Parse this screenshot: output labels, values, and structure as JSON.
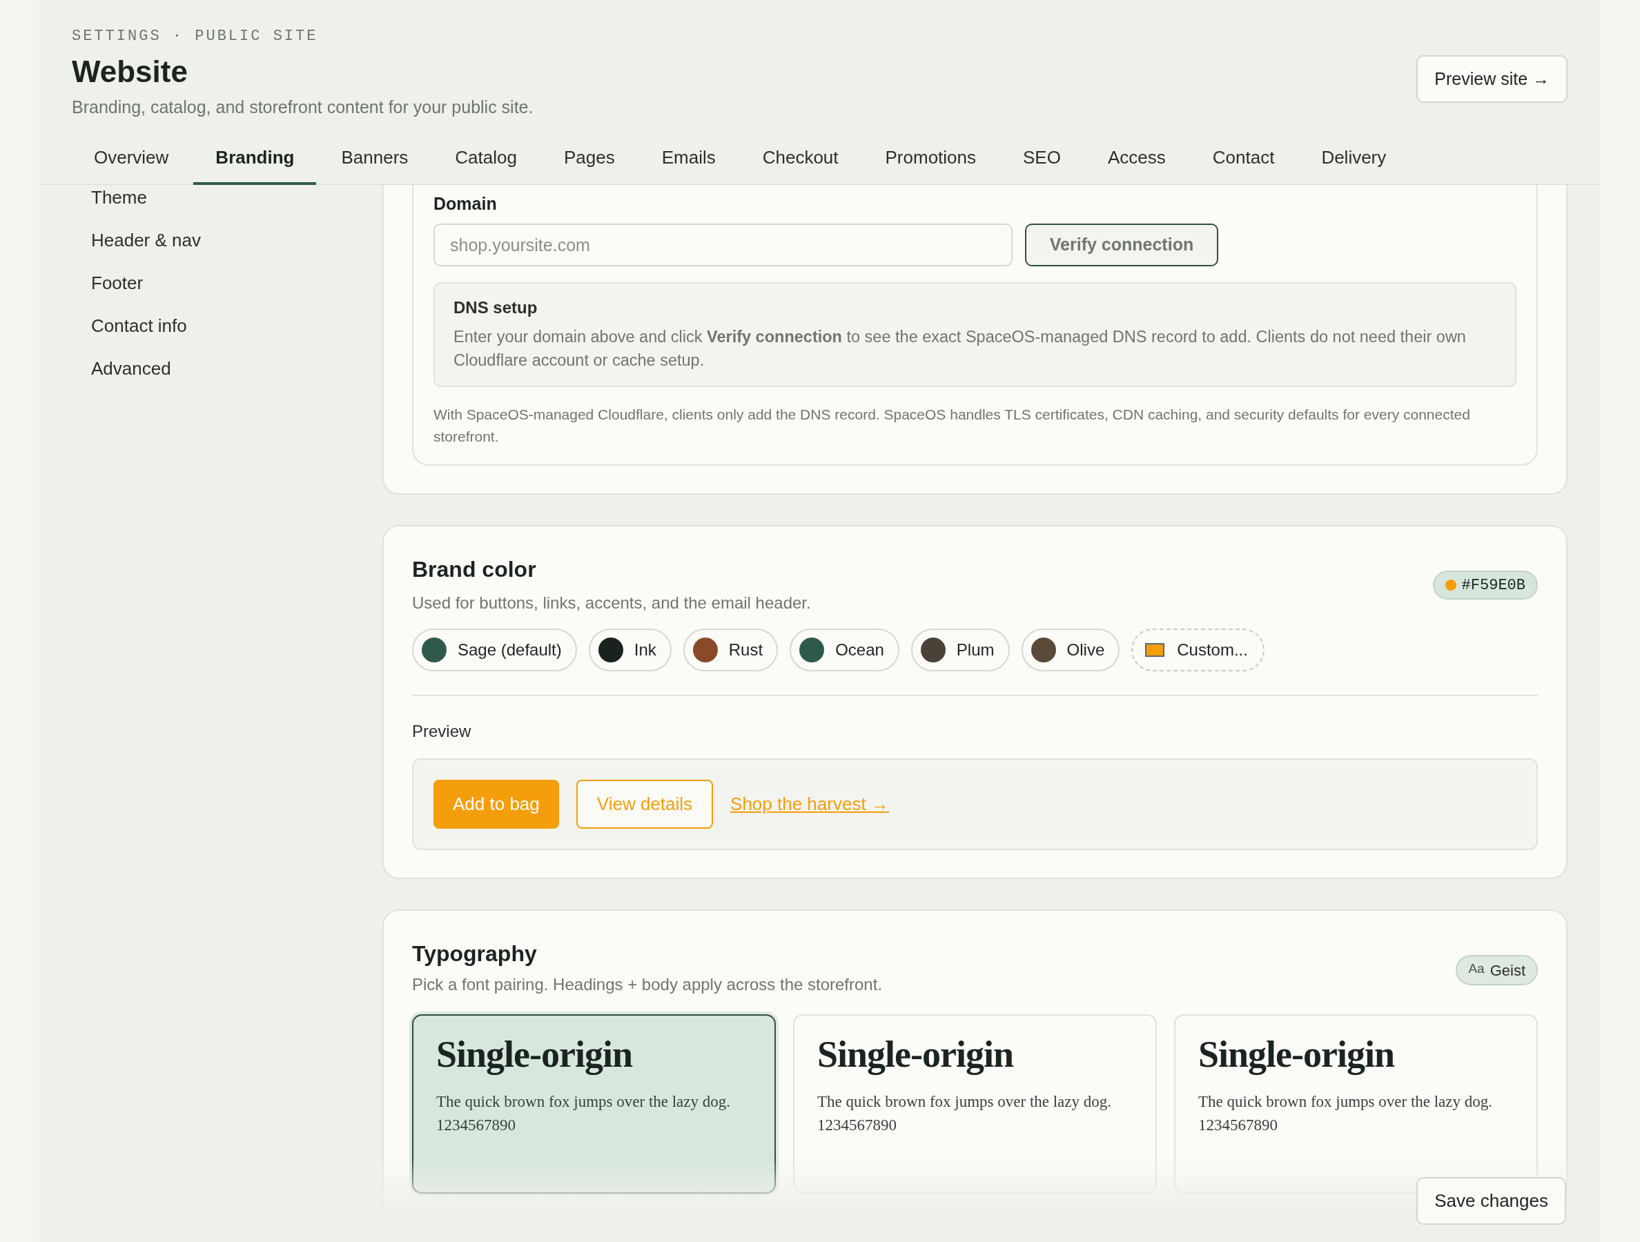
{
  "header": {
    "eyebrow": "SETTINGS · PUBLIC SITE",
    "title": "Website",
    "subtitle": "Branding, catalog, and storefront content for your public site.",
    "preview_button": "Preview site →"
  },
  "tabs": [
    {
      "label": "Overview",
      "selected": false
    },
    {
      "label": "Branding",
      "selected": true
    },
    {
      "label": "Banners",
      "selected": false
    },
    {
      "label": "Catalog",
      "selected": false
    },
    {
      "label": "Pages",
      "selected": false
    },
    {
      "label": "Emails",
      "selected": false
    },
    {
      "label": "Checkout",
      "selected": false
    },
    {
      "label": "Promotions",
      "selected": false
    },
    {
      "label": "SEO",
      "selected": false
    },
    {
      "label": "Access",
      "selected": false
    },
    {
      "label": "Contact",
      "selected": false
    },
    {
      "label": "Delivery",
      "selected": false
    }
  ],
  "sidebar": {
    "items": [
      "Theme",
      "Header & nav",
      "Footer",
      "Contact info",
      "Advanced"
    ]
  },
  "domain": {
    "label": "Domain",
    "placeholder": "shop.yoursite.com",
    "verify_button": "Verify connection",
    "dns_title": "DNS setup",
    "dns_text": "Enter your domain above and click **Verify connection** to see the exact SpaceOS-managed DNS record to add. Clients do not need their own Cloudflare account or cache setup.",
    "note": "With SpaceOS-managed Cloudflare, clients only add the DNS record. SpaceOS handles TLS certificates, CDN caching, and security defaults for every connected storefront."
  },
  "brand_color": {
    "title": "Brand color",
    "subtitle": "Used for buttons, links, accents, and the email header.",
    "badge": "#F59E0B",
    "swatches": [
      {
        "label": "Sage (default)",
        "kind": "preset",
        "color": "#2f5a4a"
      },
      {
        "label": "Ink",
        "kind": "preset",
        "color": "#1a221e"
      },
      {
        "label": "Rust",
        "kind": "preset",
        "color": "#8a4a2a"
      },
      {
        "label": "Ocean",
        "kind": "preset",
        "color": "#2e5a4c"
      },
      {
        "label": "Plum",
        "kind": "preset",
        "color": "#4a4238"
      },
      {
        "label": "Olive",
        "kind": "preset",
        "color": "#5a4a3a"
      },
      {
        "label": "Custom...",
        "kind": "custom",
        "color": "#f59e0b"
      }
    ],
    "preview_label": "Preview",
    "preview": {
      "primary_button": "Add to bag",
      "secondary_button": "View details",
      "link": "Shop the harvest →"
    }
  },
  "typography": {
    "title": "Typography",
    "subtitle": "Pick a font pairing. Headings + body apply across the storefront.",
    "badge_prefix": "Aa",
    "badge": "Geist",
    "pairings": [
      {
        "heading": "Single-origin",
        "body": "The quick brown fox jumps over the lazy dog.",
        "digits": "1234567890",
        "selected": true
      },
      {
        "heading": "Single-origin",
        "body": "The quick brown fox jumps over the lazy dog.",
        "digits": "1234567890",
        "selected": false
      },
      {
        "heading": "Single-origin",
        "body": "The quick brown fox jumps over the lazy dog.",
        "digits": "1234567890",
        "selected": false
      }
    ]
  },
  "save_button": "Save changes"
}
